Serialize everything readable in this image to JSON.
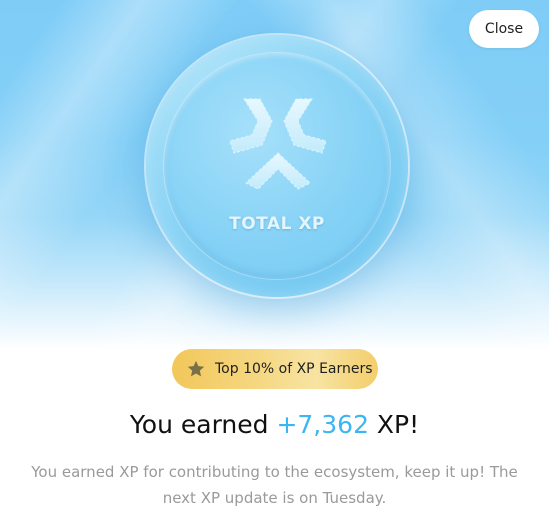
{
  "close_button": {
    "label": "Close"
  },
  "coin": {
    "label": "TOTAL XP",
    "logo_icon": "xp-logo-icon"
  },
  "badge": {
    "icon": "star-icon",
    "label": "Top 10% of XP Earners"
  },
  "headline": {
    "prefix": "You earned ",
    "amount": "+7,362",
    "suffix": " XP!"
  },
  "description": "You earned XP for contributing to the ecosystem, keep it up! The next XP update is on Tuesday.",
  "colors": {
    "hero_top": "#7fcdf7",
    "accent_amount": "#3bb6f0",
    "badge_gold": "#f2c75a",
    "description_text": "#9a9a9a"
  }
}
